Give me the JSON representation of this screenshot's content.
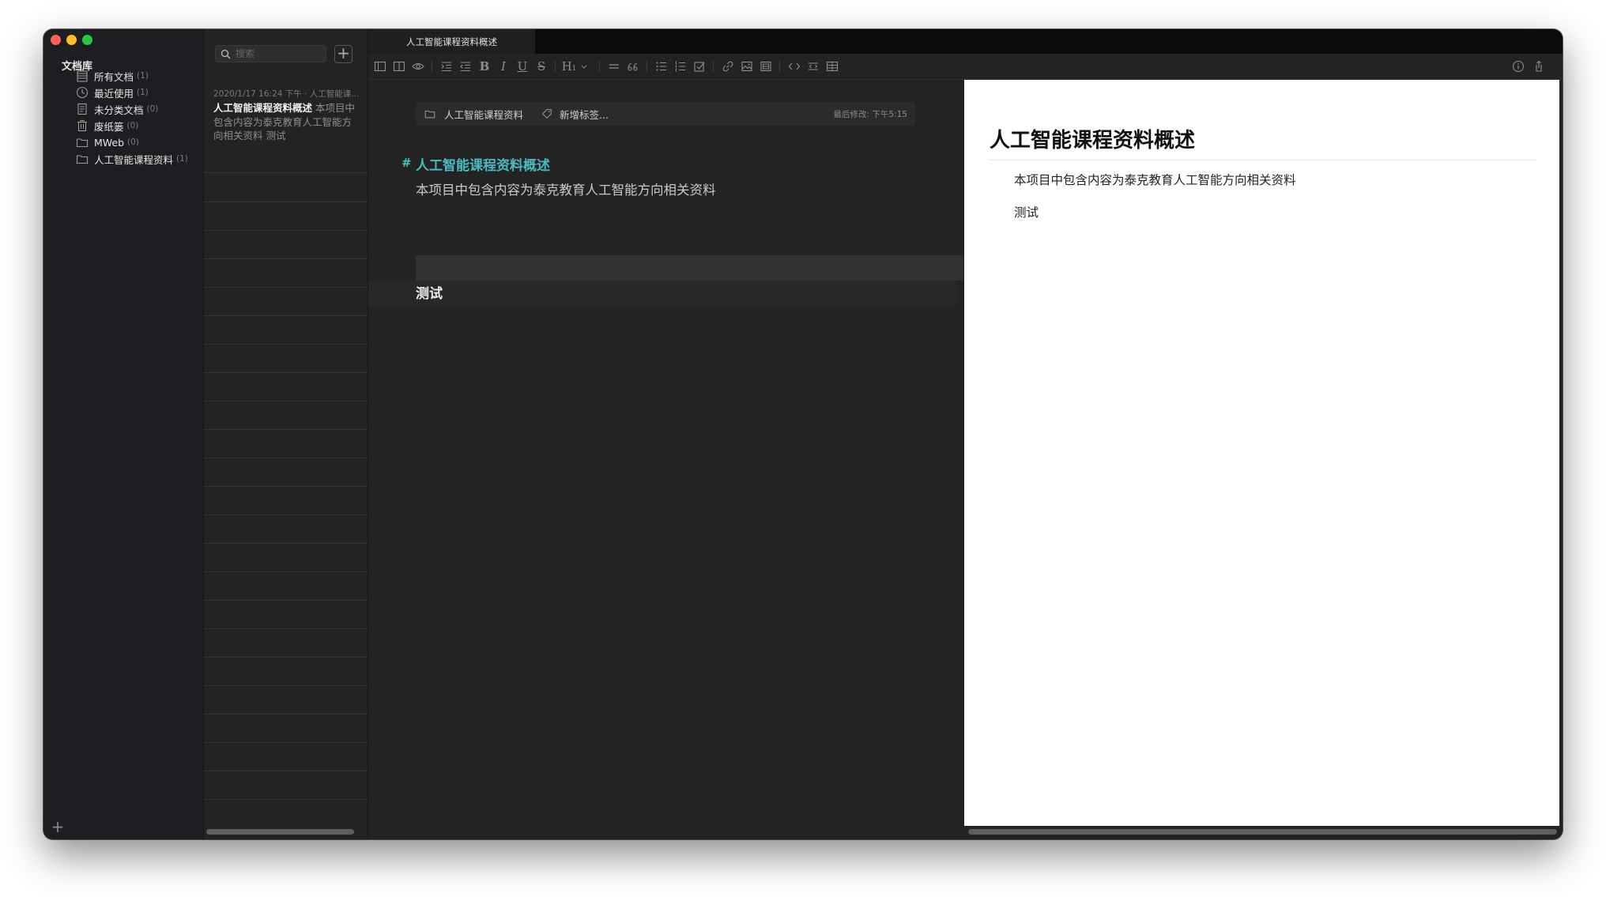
{
  "sidebar": {
    "title": "文档库",
    "categories": [
      {
        "label": "所有文档",
        "count": "(1)"
      },
      {
        "label": "最近使用",
        "count": "(1)"
      },
      {
        "label": "未分类文档",
        "count": "(0)"
      },
      {
        "label": "废纸篓",
        "count": "(0)"
      },
      {
        "label": "MWeb",
        "count": "(0)"
      },
      {
        "label": "人工智能课程资料",
        "count": "(1)"
      }
    ],
    "add_label": "+"
  },
  "notelist": {
    "search_placeholder": "搜索",
    "new_label": "+",
    "note": {
      "meta": "2020/1/17 16:24 下午 · 人工智能课...",
      "title": "人工智能课程资料概述",
      "snippet": "本项目中包含内容为泰克教育人工智能方向相关资料  测试"
    }
  },
  "tab": {
    "title": "人工智能课程资料概述"
  },
  "toolbar": {
    "bold": "B",
    "italic": "I",
    "underline": "U",
    "strike": "S",
    "heading": "H",
    "heading_sub": "1"
  },
  "editor": {
    "meta": {
      "folder": "人工智能课程资料",
      "tag_placeholder": "新增标签...",
      "modified": "最后修改: 下午5:15"
    },
    "hash": "#",
    "heading": "人工智能课程资料概述",
    "paragraph": "本项目中包含内容为泰克教育人工智能方向相关资料",
    "test": "测试"
  },
  "preview": {
    "heading": "人工智能课程资料概述",
    "paragraph": "本项目中包含内容为泰克教育人工智能方向相关资料",
    "test": "测试"
  },
  "colors": {
    "heading_accent": "#4bbac0",
    "sidebar_bg": "#1c1e21",
    "editor_bg": "#232323"
  }
}
